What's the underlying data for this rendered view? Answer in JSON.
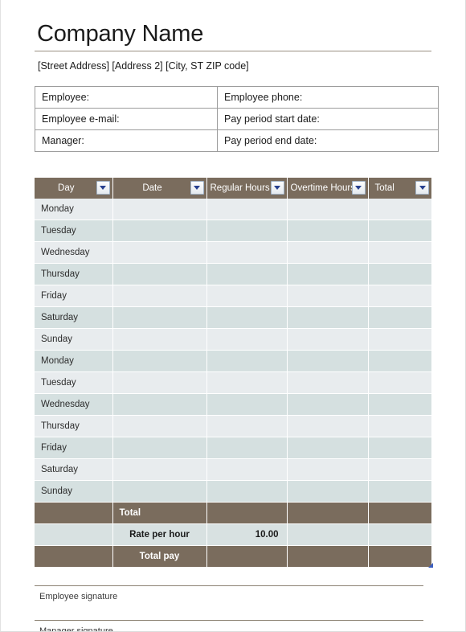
{
  "company": {
    "name": "Company Name",
    "address": "[Street Address] [Address 2] [City, ST ZIP code]"
  },
  "info": {
    "rows": [
      {
        "left": "Employee:",
        "right": "Employee phone:"
      },
      {
        "left": "Employee e-mail:",
        "right": "Pay period start date:"
      },
      {
        "left": "Manager:",
        "right": "Pay period end date:"
      }
    ]
  },
  "timesheet": {
    "headers": [
      {
        "label": "Day",
        "filter": "filter-dropdown-icon"
      },
      {
        "label": "Date",
        "filter": "filter-dropdown-icon"
      },
      {
        "label": "Regular Hours",
        "filter": "filter-dropdown-icon"
      },
      {
        "label": "Overtime Hours",
        "filter": "filter-dropdown-icon"
      },
      {
        "label": "Total",
        "filter": "filter-dropdown-icon"
      }
    ],
    "rows": [
      {
        "day": "Monday",
        "date": "",
        "regular": "",
        "overtime": "",
        "total": ""
      },
      {
        "day": "Tuesday",
        "date": "",
        "regular": "",
        "overtime": "",
        "total": ""
      },
      {
        "day": "Wednesday",
        "date": "",
        "regular": "",
        "overtime": "",
        "total": ""
      },
      {
        "day": "Thursday",
        "date": "",
        "regular": "",
        "overtime": "",
        "total": ""
      },
      {
        "day": "Friday",
        "date": "",
        "regular": "",
        "overtime": "",
        "total": ""
      },
      {
        "day": "Saturday",
        "date": "",
        "regular": "",
        "overtime": "",
        "total": ""
      },
      {
        "day": "Sunday",
        "date": "",
        "regular": "",
        "overtime": "",
        "total": ""
      },
      {
        "day": "Monday",
        "date": "",
        "regular": "",
        "overtime": "",
        "total": ""
      },
      {
        "day": "Tuesday",
        "date": "",
        "regular": "",
        "overtime": "",
        "total": ""
      },
      {
        "day": "Wednesday",
        "date": "",
        "regular": "",
        "overtime": "",
        "total": ""
      },
      {
        "day": "Thursday",
        "date": "",
        "regular": "",
        "overtime": "",
        "total": ""
      },
      {
        "day": "Friday",
        "date": "",
        "regular": "",
        "overtime": "",
        "total": ""
      },
      {
        "day": "Saturday",
        "date": "",
        "regular": "",
        "overtime": "",
        "total": ""
      },
      {
        "day": "Sunday",
        "date": "",
        "regular": "",
        "overtime": "",
        "total": ""
      }
    ],
    "footer": [
      {
        "style": "brown",
        "align": "left",
        "label": "Total",
        "regular": "",
        "overtime": "",
        "total": ""
      },
      {
        "style": "light",
        "align": "center",
        "label": "Rate per hour",
        "regular": "10.00",
        "overtime": "",
        "total": ""
      },
      {
        "style": "brown",
        "align": "center",
        "label": "Total pay",
        "regular": "",
        "overtime": "",
        "total": ""
      }
    ]
  },
  "signatures": [
    {
      "label": "Employee signature"
    },
    {
      "label": "Manager signature"
    }
  ],
  "colors": {
    "header_brown": "#7a6c5d",
    "row_light": "#e8ecee",
    "row_dark": "#d5e0e0",
    "footer_light": "#d8e1e1",
    "rule": "#9a8f82",
    "filter_triangle": "#27408f",
    "resize_handle": "#3b5ec0"
  }
}
